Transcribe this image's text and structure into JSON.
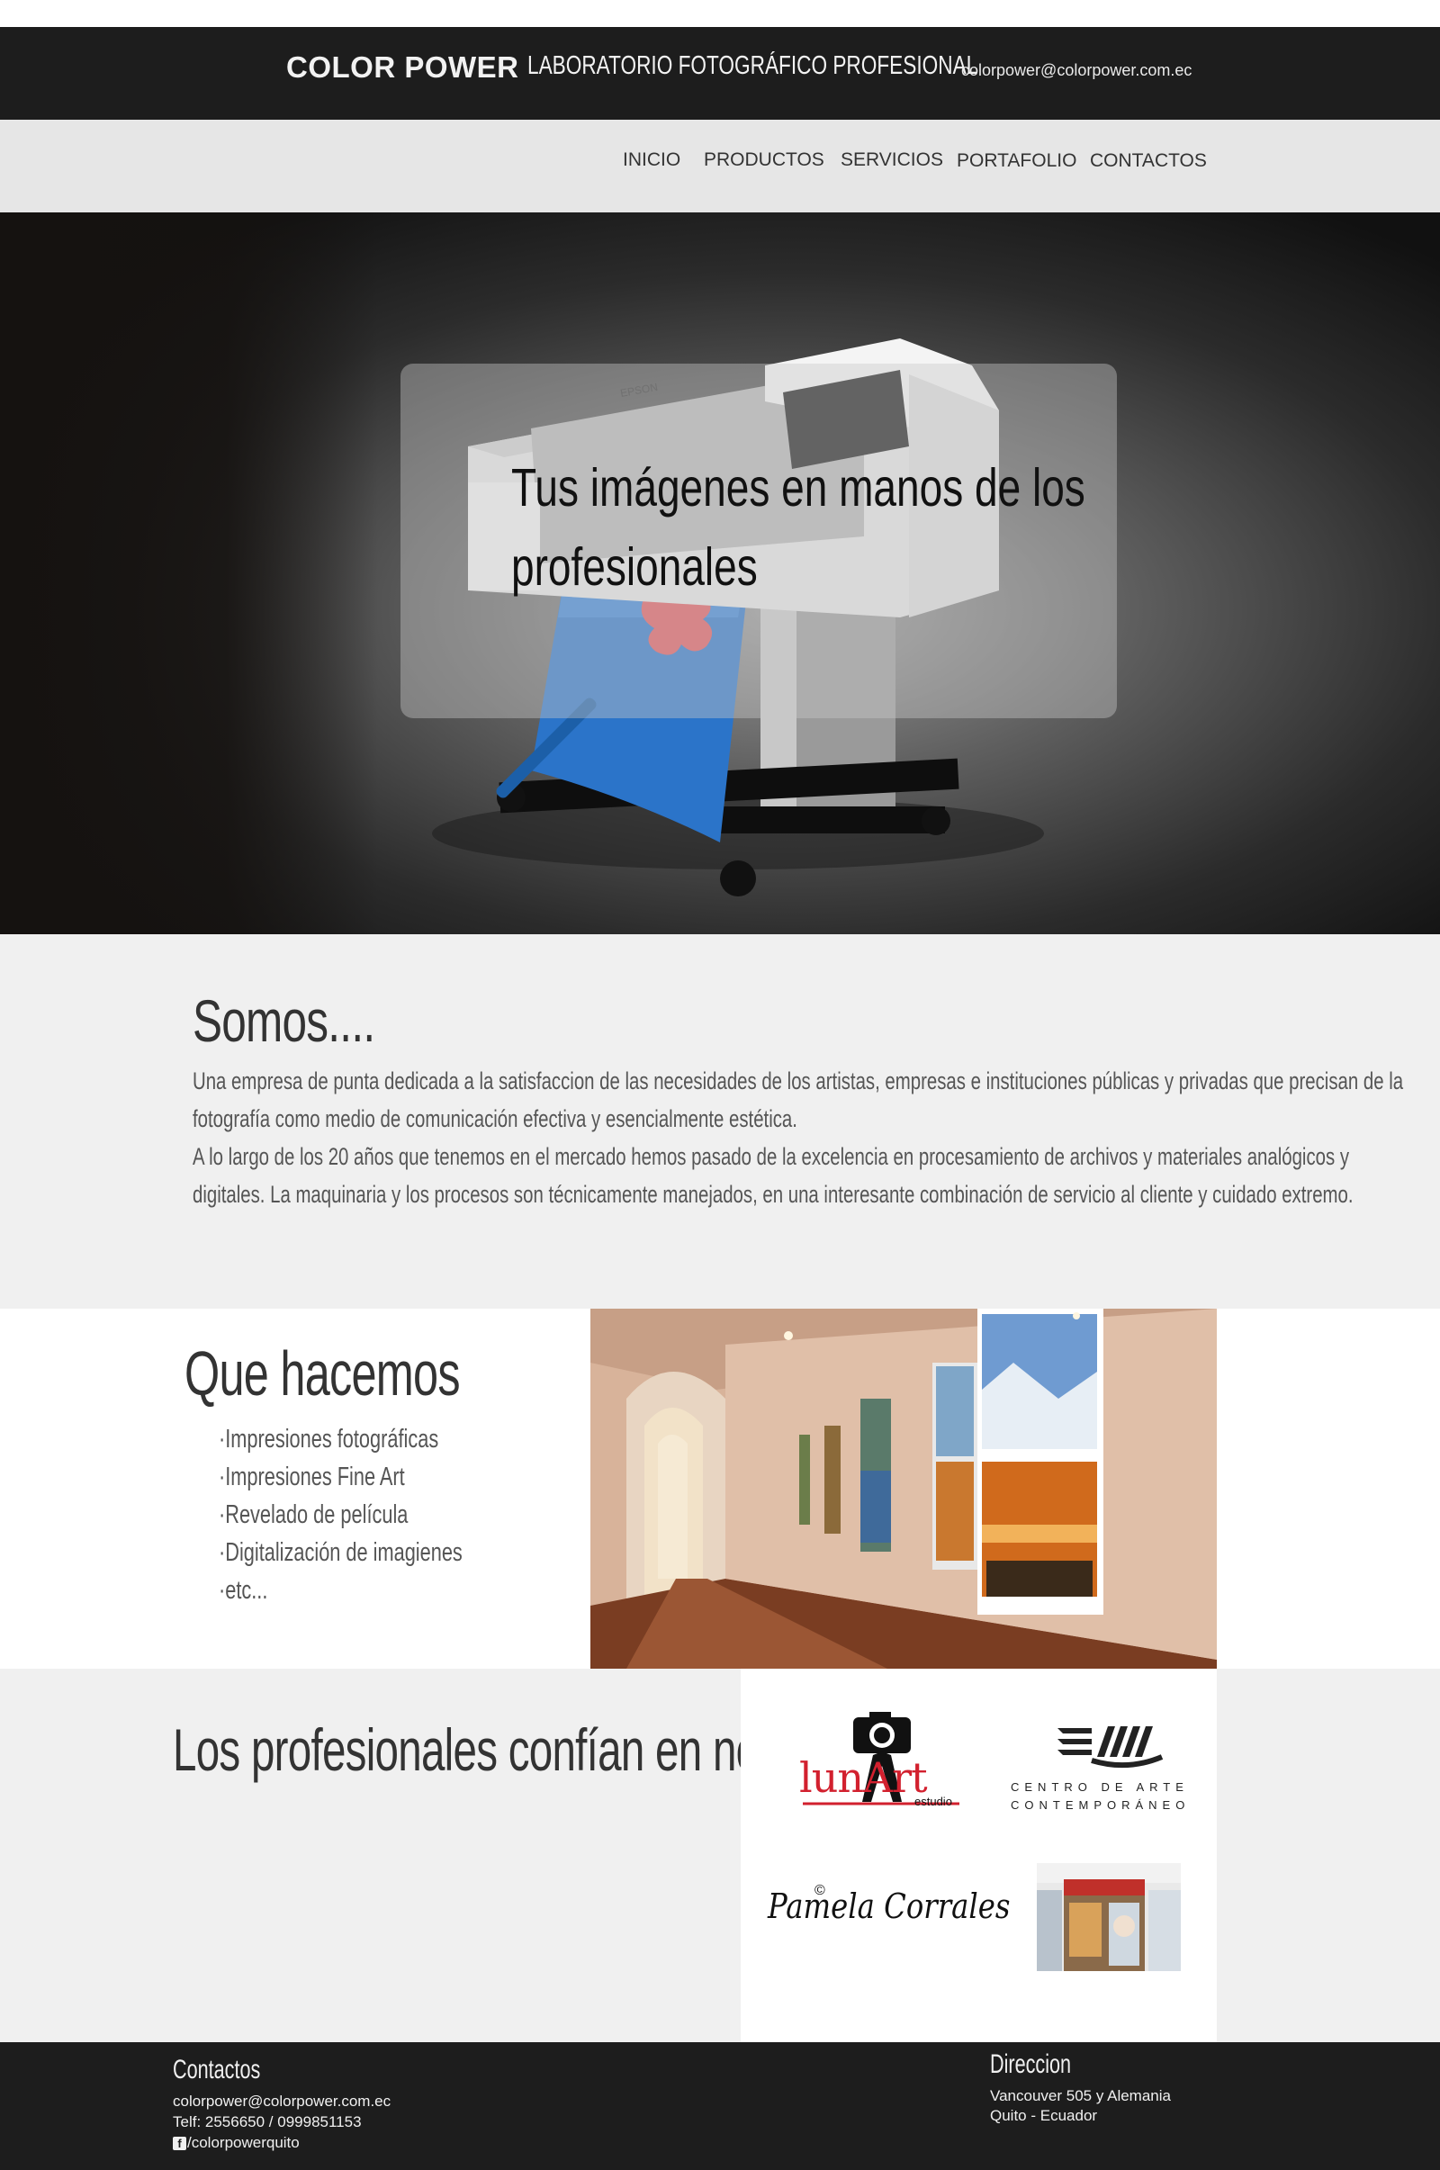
{
  "header": {
    "brand": "COLOR POWER",
    "tagline": "LABORATORIO FOTOGRÁFICO PROFESIONAL",
    "email": "colorpower@colorpower.com.ec"
  },
  "nav": {
    "items": [
      "INICIO",
      "PRODUCTOS",
      "SERVICIOS",
      "PORTAFOLIO",
      "CONTACTOS"
    ]
  },
  "hero": {
    "line1": "Tus imágenes en manos de los",
    "line2": "profesionales",
    "printer_brand": "EPSON"
  },
  "somos": {
    "title": "Somos....",
    "lines": [
      "Una empresa de punta dedicada a la satisfaccion de las necesidades de los artistas, empresas e instituciones públicas y privadas que precisan de la",
      "fotografía como medio de comunicación efectiva y esencialmente estética.",
      "A lo largo de los 20 años que tenemos en el mercado hemos pasado de la excelencia en procesamiento de archivos y materiales analógicos y",
      "digitales. La maquinaria y los procesos son técnicamente manejados, en una interesante combinación de servicio al cliente y cuidado extremo."
    ]
  },
  "hacemos": {
    "title": "Que hacemos",
    "items": [
      "·Impresiones fotográficas",
      "·Impresiones Fine Art",
      "·Revelado de película",
      "·Digitalización de imagienes",
      "·etc..."
    ]
  },
  "confian": {
    "title": "Los profesionales confían en nosotros",
    "logos": {
      "lunart_main": "lunArt",
      "lunart_sub": "estudio",
      "centro_line1": "CENTRO DE ARTE",
      "centro_line2": "CONTEMPORÁNEO",
      "pamela": "Pamela Corrales"
    }
  },
  "footer": {
    "contact_title": "Contactos",
    "contact_email": "colorpower@colorpower.com.ec",
    "contact_phone": "Telf: 2556650 / 0999851153",
    "contact_social": "/colorpowerquito",
    "address_title": "Direccion",
    "address_line1": "Vancouver 505 y Alemania",
    "address_line2": "Quito - Ecuador"
  },
  "colors": {
    "topbar": "#1d1d1d",
    "navbar": "#e6e6e6",
    "section_gray": "#f0f0f0",
    "lunart_red": "#d2202e"
  },
  "icons": [
    "facebook-icon"
  ]
}
